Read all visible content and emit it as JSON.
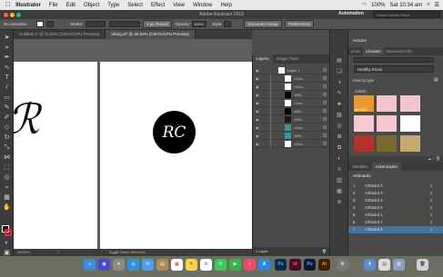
{
  "menubar": {
    "apple": "",
    "app": "Illustrator",
    "items": [
      "File",
      "Edit",
      "Object",
      "Type",
      "Select",
      "Effect",
      "View",
      "Window",
      "Help"
    ],
    "clock": "Sat 10:34 am",
    "wifi": "100%"
  },
  "window": {
    "title": "Adobe Illustrator 2019",
    "workspace": "Automation",
    "search_placeholder": "Search Adobe Stock"
  },
  "control": {
    "selection": "No Selection",
    "stroke_label": "Stroke:",
    "stroke_value": "1 pt. Round",
    "opacity_label": "Opacity:",
    "opacity_value": "100%",
    "style_label": "Style:",
    "doc_setup": "Document Setup",
    "preferences": "Preferences"
  },
  "doc_tabs": [
    {
      "label": "Untitled-1* @ 11.62% (CMYK/CPU Preview)"
    },
    {
      "label": "viking.ai* @ 28.53% (CMYK/CPU Preview)"
    }
  ],
  "canvas": {
    "logo_text": "RC"
  },
  "status": {
    "zoom": "28.53%",
    "artboard_num": "7",
    "tool": "Toggle Direct Selection"
  },
  "layers": {
    "tabs": [
      "Layers",
      "Image Trace"
    ],
    "rows": [
      "Layer 1",
      "<Gro...",
      "<Gro...",
      "<Elli...",
      "<Gro...",
      "<Elli...",
      "<Elli...",
      "<Gro...",
      "<Elli...",
      "<Gro..."
    ],
    "footer": "1 Layer"
  },
  "right": {
    "actions": "Actions",
    "tabs": [
      "Links",
      "Libraries",
      "Document Info"
    ],
    "library_name": "Healthy Roast",
    "view_by": "View by type",
    "colors_label": "Colors",
    "swatch_label": "ae7015",
    "swatch_colors": [
      "#e89a2e",
      "#f4c4cc",
      "#f3c6cf",
      "#f6c8d0",
      "#f5c6ce",
      "#ffffff",
      "#b5322c",
      "#7a6a2e",
      "#c5a86f"
    ],
    "artboard_tabs": [
      "Variables",
      "Asset Export"
    ],
    "artboards_title": "Artboards",
    "artboards": [
      {
        "num": "1",
        "name": "Artboard 2"
      },
      {
        "num": "2",
        "name": "Artboard 3"
      },
      {
        "num": "3",
        "name": "Artboard 4"
      },
      {
        "num": "4",
        "name": "Artboard 5"
      },
      {
        "num": "5",
        "name": "Artboard 1"
      },
      {
        "num": "6",
        "name": "Artboard 7"
      },
      {
        "num": "7",
        "name": "Artboard 6"
      }
    ]
  },
  "dock": {
    "apps": [
      {
        "label": "Ps",
        "color": "#0b2a4a"
      },
      {
        "label": "Id",
        "color": "#4a0b26"
      },
      {
        "label": "Ps",
        "color": "#0c1b33"
      },
      {
        "label": "Ai",
        "color": "#3a1e05"
      }
    ]
  }
}
